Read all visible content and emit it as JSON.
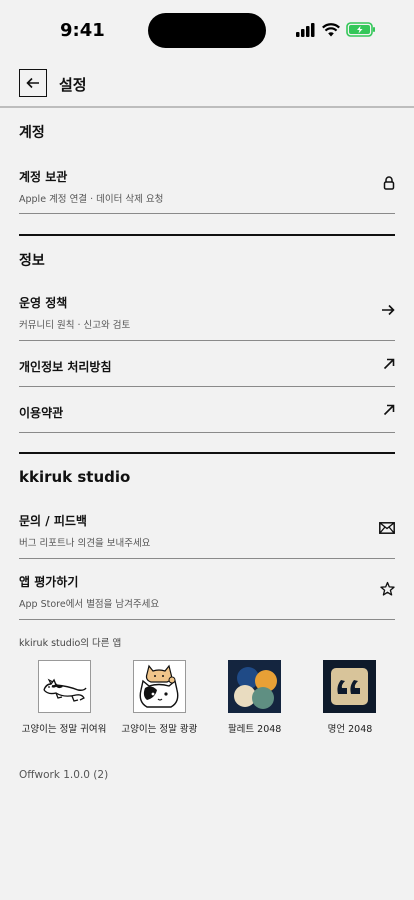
{
  "status_bar": {
    "time": "9:41"
  },
  "header": {
    "title": "설정"
  },
  "sections": {
    "account": {
      "title": "계정",
      "rows": [
        {
          "title": "계정 보관",
          "subtitle": "Apple 계정 연결 · 데이터 삭제 요청",
          "icon": "lock-icon"
        }
      ]
    },
    "info": {
      "title": "정보",
      "rows": [
        {
          "title": "운영 정책",
          "subtitle": "커뮤니티 원칙 · 신고와 검토",
          "icon": "arrow-right-icon"
        },
        {
          "title": "개인정보 처리방침",
          "icon": "external-arrow-icon"
        },
        {
          "title": "이용약관",
          "icon": "external-arrow-icon"
        }
      ]
    },
    "studio": {
      "title": "kkiruk studio",
      "rows": [
        {
          "title": "문의 / 피드백",
          "subtitle": "버그 리포트나 의견을 보내주세요",
          "icon": "mail-icon"
        },
        {
          "title": "앱 평가하기",
          "subtitle": "App Store에서 별점을 남겨주세요",
          "icon": "star-icon"
        }
      ],
      "other_apps_label": "kkiruk studio의 다른 앱",
      "apps": [
        {
          "name": "고양이는 정말 귀여워",
          "icon": "cat-lying-icon"
        },
        {
          "name": "고양이는 정말 쾅쾅",
          "icon": "cat-stack-icon"
        },
        {
          "name": "팔레트 2048",
          "icon": "palette-icon"
        },
        {
          "name": "명언 2048",
          "icon": "quote-icon"
        }
      ]
    }
  },
  "footer": {
    "version": "Offwork 1.0.0 (2)"
  },
  "colors": {
    "background": "#f2f2f2",
    "text": "#111111",
    "battery": "#34c759",
    "palette_bg": "#14253f",
    "quote_bg": "#0e1a2b",
    "quote_tile": "#d8c49a"
  }
}
